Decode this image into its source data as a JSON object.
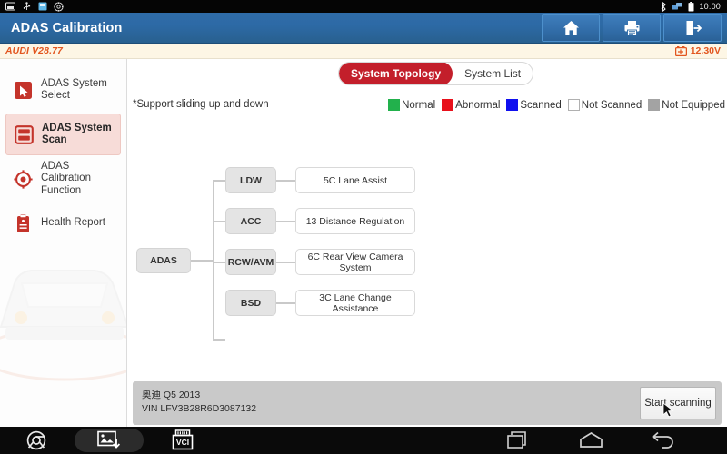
{
  "statusbar": {
    "icons": [
      "screenshot-icon",
      "usb-icon",
      "sd-card-icon",
      "settings-icon"
    ],
    "right_icons": [
      "bluetooth-icon",
      "network-icon",
      "battery-icon"
    ],
    "time": "10:00"
  },
  "header": {
    "title": "ADAS Calibration",
    "buttons": [
      {
        "name": "home-button",
        "icon": "home-icon"
      },
      {
        "name": "print-button",
        "icon": "printer-icon"
      },
      {
        "name": "exit-button",
        "icon": "exit-icon"
      }
    ]
  },
  "versionbar": {
    "version": "AUDI V28.77",
    "voltage": "12.30V",
    "battery_icon": "battery-icon"
  },
  "sidebar": {
    "items": [
      {
        "label": "ADAS System Select",
        "icon": "cursor-select-icon",
        "active": false
      },
      {
        "label": "ADAS System Scan",
        "icon": "scan-list-icon",
        "active": true
      },
      {
        "label": "ADAS Calibration Function",
        "icon": "target-icon",
        "active": false
      },
      {
        "label": "Health Report",
        "icon": "clipboard-icon",
        "active": false
      }
    ],
    "collapse_label": "|◁"
  },
  "main": {
    "tabs": [
      {
        "label": "System Topology",
        "active": true
      },
      {
        "label": "System List",
        "active": false
      }
    ],
    "hint": "*Support sliding up and down",
    "legend": [
      {
        "label": "Normal",
        "color": "#22b14c",
        "border": "#22b14c"
      },
      {
        "label": "Abnormal",
        "color": "#e8101b",
        "border": "#e8101b"
      },
      {
        "label": "Scanned",
        "color": "#1010ef",
        "border": "#1010ef"
      },
      {
        "label": "Not Scanned",
        "color": "#ffffff",
        "border": "#b0b0b0"
      },
      {
        "label": "Not Equipped",
        "color": "#a3a3a3",
        "border": "#a3a3a3"
      }
    ],
    "topology": {
      "root": "ADAS",
      "branches": [
        {
          "group": "LDW",
          "system": "5C Lane Assist"
        },
        {
          "group": "ACC",
          "system": "13 Distance Regulation"
        },
        {
          "group": "RCW/AVM",
          "system": "6C Rear View Camera System"
        },
        {
          "group": "BSD",
          "system": "3C Lane Change Assistance"
        }
      ]
    }
  },
  "vehicle": {
    "name": "奥迪 Q5 2013",
    "vin": "VIN LFV3B28R6D3087132",
    "scan_button": "Start scanning"
  },
  "navbar": {
    "items": [
      {
        "name": "browser-icon"
      },
      {
        "name": "screenshot-icon"
      },
      {
        "name": "vci-icon",
        "label": "VCI"
      },
      {
        "name": "recents-icon"
      },
      {
        "name": "home-icon"
      },
      {
        "name": "back-icon"
      }
    ]
  }
}
